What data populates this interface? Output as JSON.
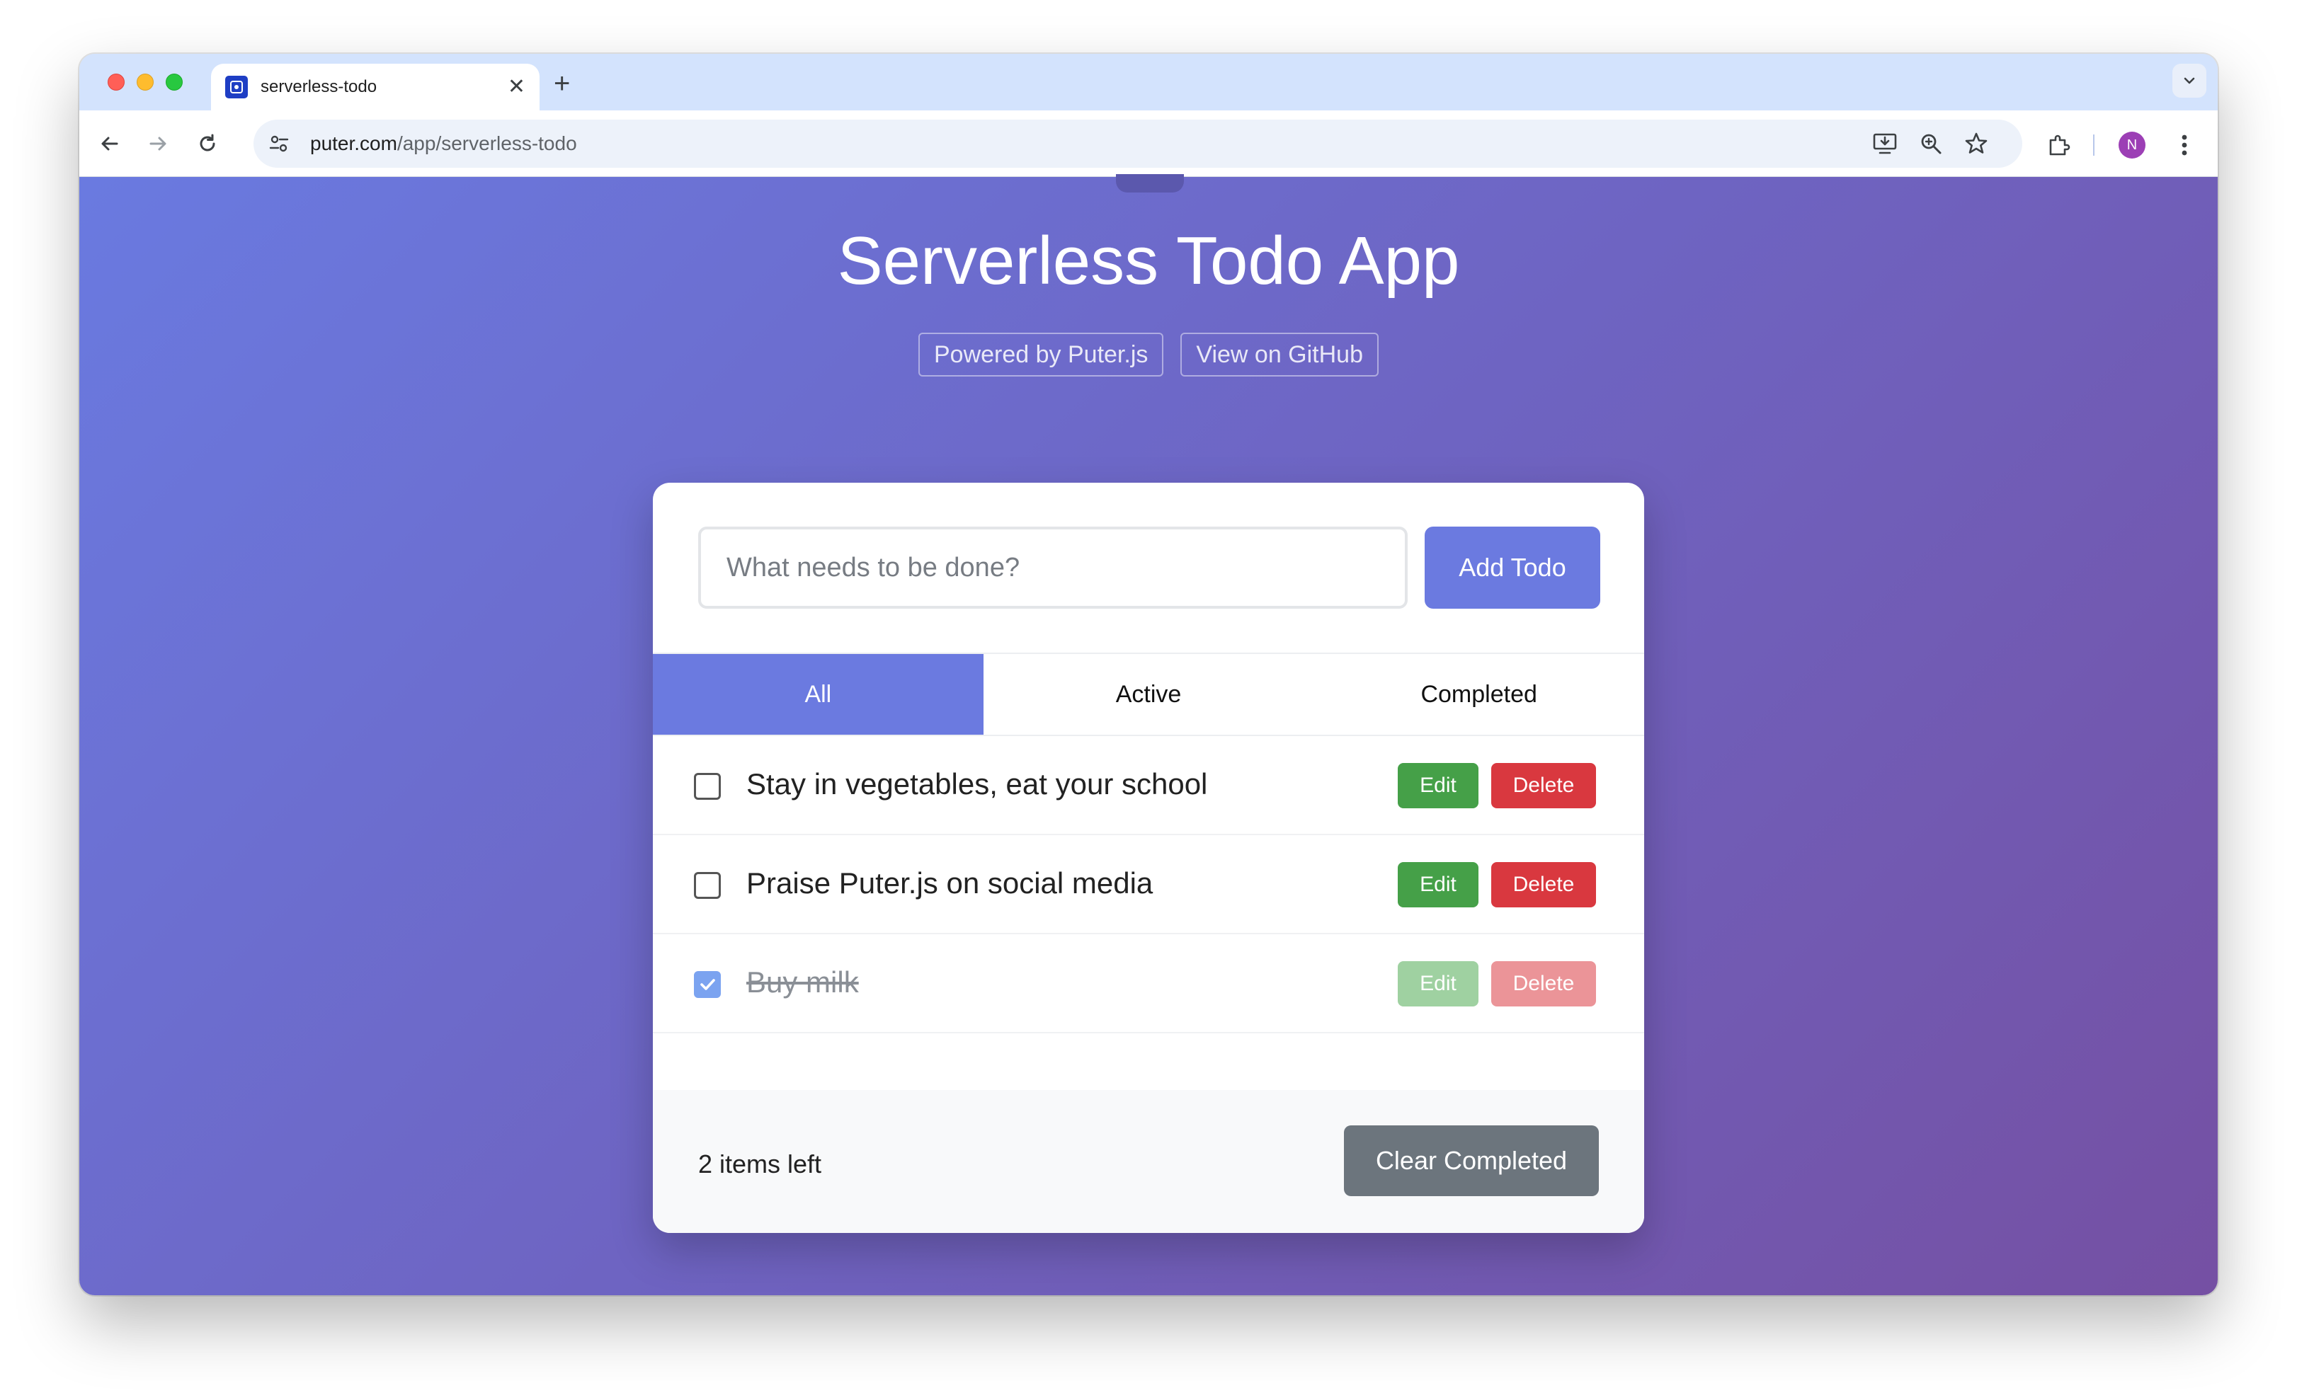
{
  "browser": {
    "tab": {
      "title": "serverless-todo",
      "favicon_icon": "puter-logo-icon",
      "close_glyph": "✕"
    },
    "new_tab_glyph": "+",
    "url": {
      "host": "puter.com",
      "path": "/app/serverless-todo"
    },
    "avatar_letter": "N",
    "icons": [
      "back-icon",
      "forward-icon",
      "reload-icon",
      "site-settings-icon",
      "install-app-icon",
      "zoom-icon",
      "bookmark-star-icon",
      "extensions-icon",
      "menu-kebab-icon",
      "tab-list-chevron-icon"
    ]
  },
  "app": {
    "title": "Serverless Todo App",
    "badges": {
      "powered_by": "Powered by Puter.js",
      "github": "View on GitHub"
    },
    "input_placeholder": "What needs to be done?",
    "add_button": "Add Todo",
    "filters": [
      {
        "label": "All",
        "active": true
      },
      {
        "label": "Active",
        "active": false
      },
      {
        "label": "Completed",
        "active": false
      }
    ],
    "todos": [
      {
        "text": "Stay in vegetables, eat your school",
        "completed": false,
        "edit_label": "Edit",
        "delete_label": "Delete"
      },
      {
        "text": "Praise Puter.js on social media",
        "completed": false,
        "edit_label": "Edit",
        "delete_label": "Delete"
      },
      {
        "text": "Buy milk",
        "completed": true,
        "edit_label": "Edit",
        "delete_label": "Delete"
      }
    ],
    "items_left": "2 items left",
    "clear_button": "Clear Completed"
  },
  "colors": {
    "accent": "#6b7ae0",
    "edit": "#45a048",
    "delete": "#d9383f",
    "clear": "#6c757d"
  }
}
